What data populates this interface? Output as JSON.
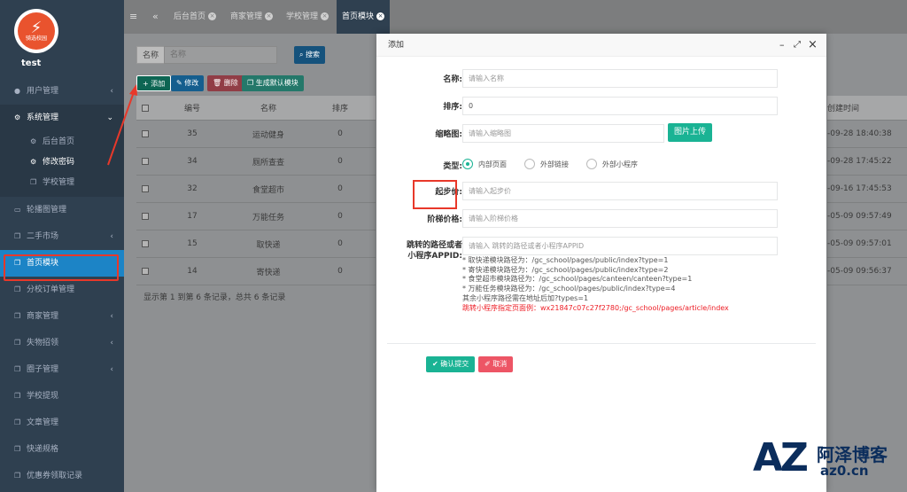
{
  "sidebar": {
    "logo_text": "骑选校园",
    "user_name": "test",
    "items": [
      {
        "label": "用户管理",
        "icon": "user-icon",
        "arrow": "‹"
      },
      {
        "label": "系统管理",
        "icon": "gears-icon",
        "arrow": "⌄"
      },
      {
        "label": "轮播图管理",
        "icon": "monitor-icon"
      },
      {
        "label": "二手市场",
        "icon": "copy-icon",
        "arrow": "‹"
      },
      {
        "label": "首页模块",
        "icon": "copy-icon"
      },
      {
        "label": "分校订单管理",
        "icon": "copy-icon"
      },
      {
        "label": "商家管理",
        "icon": "copy-icon",
        "arrow": "‹"
      },
      {
        "label": "失物招领",
        "icon": "copy-icon",
        "arrow": "‹"
      },
      {
        "label": "圈子管理",
        "icon": "copy-icon",
        "arrow": "‹"
      },
      {
        "label": "学校提现",
        "icon": "copy-icon"
      },
      {
        "label": "文章管理",
        "icon": "copy-icon"
      },
      {
        "label": "快递规格",
        "icon": "copy-icon"
      },
      {
        "label": "优惠券领取记录",
        "icon": "copy-icon"
      }
    ],
    "sub_items": [
      {
        "label": "后台首页",
        "icon": "gears-icon"
      },
      {
        "label": "修改密码",
        "icon": "gears-icon"
      },
      {
        "label": "学校管理",
        "icon": "copy-icon"
      }
    ]
  },
  "topbar": {
    "tabs": [
      {
        "label": "后台首页"
      },
      {
        "label": "商家管理"
      },
      {
        "label": "学校管理"
      },
      {
        "label": "首页模块"
      }
    ]
  },
  "list": {
    "search_label": "名称",
    "search_placeholder": "名称",
    "search_button": "搜索",
    "btn_add": "添加",
    "btn_edit": "修改",
    "btn_delete": "删除",
    "btn_generate": "生成默认模块",
    "columns": [
      "编号",
      "名称",
      "排序"
    ],
    "rows": [
      {
        "id": "35",
        "name": "运动健身",
        "sort": "0"
      },
      {
        "id": "34",
        "name": "厕所查查",
        "sort": "0"
      },
      {
        "id": "32",
        "name": "食堂超市",
        "sort": "0"
      },
      {
        "id": "17",
        "name": "万能任务",
        "sort": "0"
      },
      {
        "id": "15",
        "name": "取快递",
        "sort": "0"
      },
      {
        "id": "14",
        "name": "寄快递",
        "sort": "0"
      }
    ],
    "footer": "显示第 1 到第 6 条记录，总共 6 条记录",
    "right_col_header": "创建时间",
    "right_col_values": [
      "-09-28 18:40:38",
      "-09-28 17:45:22",
      "-09-16 17:45:53",
      "-05-09 09:57:49",
      "-05-09 09:57:01",
      "-05-09 09:56:37"
    ]
  },
  "dialog": {
    "title": "添加",
    "name_label": "名称:",
    "name_placeholder": "请输入名称",
    "sort_label": "排序:",
    "sort_value": "0",
    "thumb_label": "缩略图:",
    "thumb_placeholder": "请输入缩略图",
    "upload_button": "图片上传",
    "type_label": "类型:",
    "type_options": [
      "内部页面",
      "外部链接",
      "外部小程序"
    ],
    "type_selected": "内部页面",
    "start_price_label": "起步价:",
    "start_price_placeholder": "请输入起步价",
    "step_price_label": "阶梯价格:",
    "step_price_placeholder": "请输入阶梯价格",
    "path_label_line1": "跳转的路径或者",
    "path_label_line2": "小程序APPID:",
    "path_placeholder": "请输入 跳转的路径或者小程序APPID",
    "notes": [
      "* 取快递模块路径为：/gc_school/pages/public/index?type=1",
      "* 寄快递模块路径为：/gc_school/pages/public/index?type=2",
      "* 食堂超市模块路径为：/gc_school/pages/canteen/canteen?type=1",
      "* 万能任务模块路径为：/gc_school/pages/public/index?type=4",
      "其余小程序路径需在地址后加?types=1"
    ],
    "red_note": "跳转小程序指定页面例：wx21847c07c27f2780;/gc_school/pages/article/index",
    "confirm_button": "确认提交",
    "cancel_button": "取消"
  },
  "watermark": {
    "logo": "AZ",
    "name": "阿泽博客",
    "url": "az0.cn"
  },
  "colors": {
    "sidebar_bg": "#2f4050",
    "active_menu": "#1c84c6",
    "primary_green": "#1ab394",
    "danger_red": "#ed5565",
    "annotation_red": "#e8382a"
  }
}
